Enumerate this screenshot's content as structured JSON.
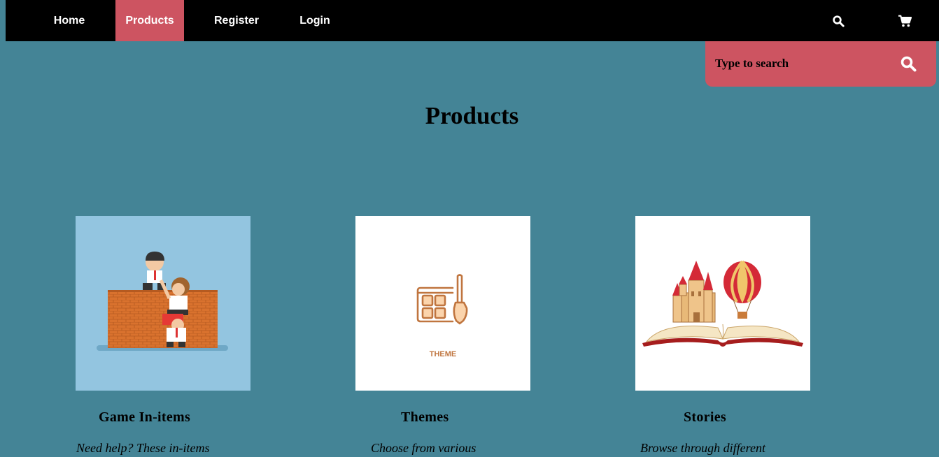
{
  "nav": {
    "items": [
      {
        "label": "Home"
      },
      {
        "label": "Products"
      },
      {
        "label": "Register"
      },
      {
        "label": "Login"
      }
    ],
    "active": "Products",
    "icons": [
      "search-icon",
      "cart-icon"
    ]
  },
  "search": {
    "placeholder": "Type to search",
    "button_icon": "search-icon"
  },
  "page": {
    "title": "Products"
  },
  "products": [
    {
      "title": "Game In-items",
      "desc": "Need help? These in-items"
    },
    {
      "title": "Themes",
      "desc": "Choose from various",
      "image_caption": "THEME"
    },
    {
      "title": "Stories",
      "desc": "Browse through different"
    }
  ],
  "colors": {
    "background": "#448496",
    "navbar": "#000000",
    "accent": "#cd5461"
  }
}
